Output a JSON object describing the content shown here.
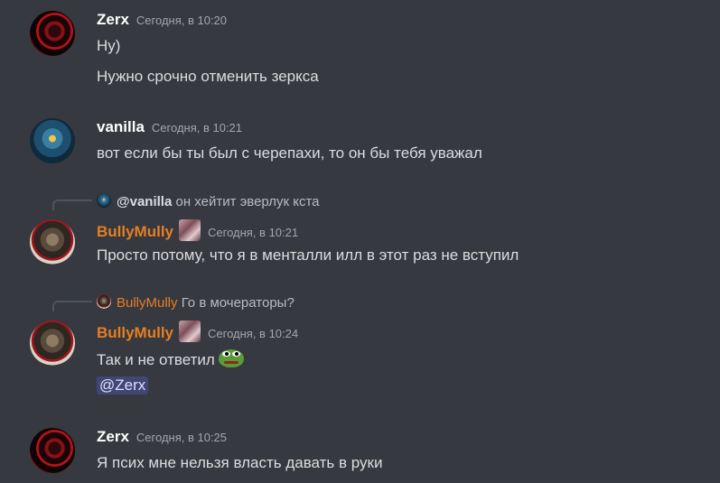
{
  "messages": [
    {
      "author": "Zerx",
      "time": "Сегодня, в 10:20",
      "lines": [
        "Ну)",
        "Нужно срочно отменить зеркса"
      ]
    },
    {
      "author": "vanilla",
      "time": "Сегодня, в 10:21",
      "lines": [
        "вот если бы ты был с черепахи, то он бы тебя уважал"
      ]
    },
    {
      "reply": {
        "author": "@vanilla",
        "text": "он хейтит эверлук кста"
      },
      "author": "BullyMully",
      "time": "Сегодня, в 10:21",
      "lines": [
        "Просто потому, что я в менталли илл в этот раз не вступил"
      ]
    },
    {
      "reply": {
        "author": "BullyMully",
        "text": "Го в мочераторы?"
      },
      "author": "BullyMully",
      "time": "Сегодня, в 10:24",
      "lines": [
        "Так и не ответил"
      ],
      "mention": "@Zerx"
    },
    {
      "author": "Zerx",
      "time": "Сегодня, в 10:25",
      "lines": [
        "Я псих мне нельзя власть давать в руки"
      ]
    }
  ],
  "colors": {
    "background": "#36393f",
    "role_orange": "#e67e22",
    "mention_bg": "#414675"
  },
  "icons": {
    "emoji": "pepe-emoji",
    "role_badge": "role-badge-icon"
  }
}
